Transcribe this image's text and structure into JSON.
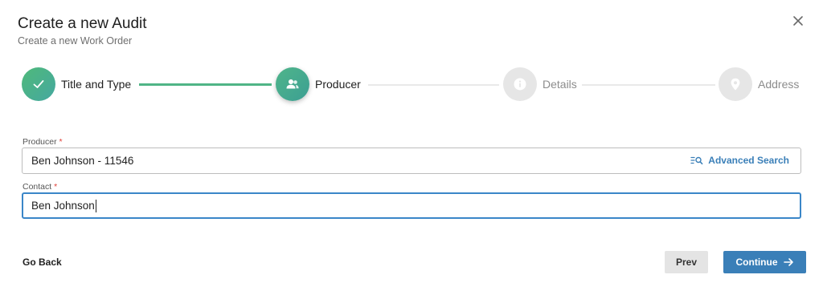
{
  "dialog": {
    "title": "Create a new Audit",
    "subtitle": "Create a new Work Order",
    "close_icon": "close-icon"
  },
  "stepper": {
    "steps": [
      {
        "label": "Title and Type",
        "state": "completed",
        "icon": "check-icon"
      },
      {
        "label": "Producer",
        "state": "active",
        "icon": "users-icon"
      },
      {
        "label": "Details",
        "state": "pending",
        "icon": "info-icon"
      },
      {
        "label": "Address",
        "state": "pending",
        "icon": "map-pin-icon"
      }
    ],
    "colors": {
      "accent": "#4fb586",
      "pending": "#e6e6e6"
    }
  },
  "form": {
    "producer": {
      "label": "Producer",
      "required_mark": "*",
      "value": "Ben Johnson - 11546",
      "advanced_search_label": "Advanced Search",
      "advanced_search_icon": "search-list-icon"
    },
    "contact": {
      "label": "Contact",
      "required_mark": "*",
      "value": "Ben Johnson"
    }
  },
  "footer": {
    "go_back_label": "Go Back",
    "prev_label": "Prev",
    "continue_label": "Continue",
    "continue_icon": "arrow-right-icon",
    "colors": {
      "primary": "#3a7fb8",
      "secondary": "#e4e4e4"
    }
  }
}
